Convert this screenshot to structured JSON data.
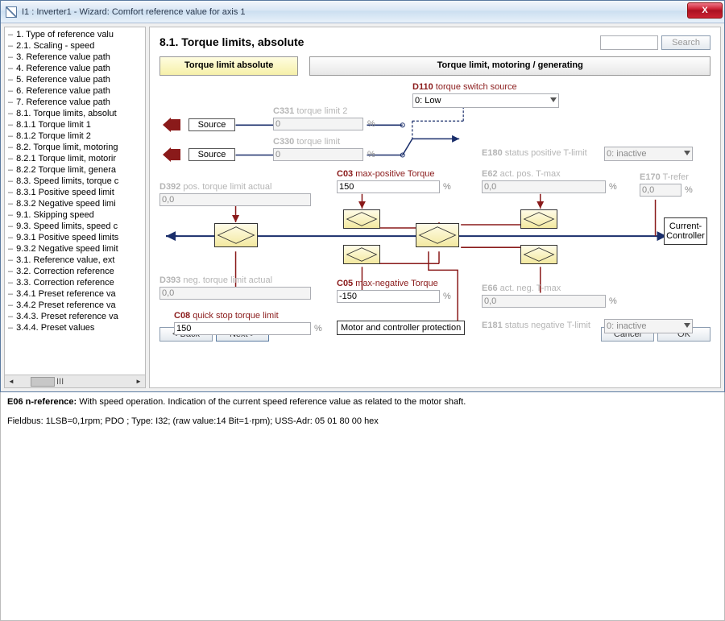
{
  "window": {
    "title": "I1 : Inverter1 - Wizard: Comfort reference value for axis 1",
    "close": "X"
  },
  "sidebar": {
    "items": [
      "1. Type of reference valu",
      "2.1. Scaling - speed",
      "3. Reference value path",
      "4. Reference value path",
      "5. Reference value path",
      "6. Reference value path",
      "7. Reference value path",
      "8.1. Torque limits, absolut",
      "8.1.1 Torque limit 1",
      "8.1.2 Torque limit 2",
      "8.2. Torque limit, motoring",
      "8.2.1 Torque limit, motorir",
      "8.2.2 Torque limit, genera",
      "8.3. Speed limits, torque c",
      "8.3.1 Positive speed limit",
      "8.3.2 Negative speed limi",
      "9.1. Skipping speed",
      "9.3. Speed limits, speed c",
      "9.3.1 Positive speed limits",
      "9.3.2 Negative speed limit",
      "3.1. Reference value, ext",
      "3.2. Correction reference",
      "3.3. Correction reference",
      "3.4.1 Preset reference va",
      "3.4.2 Preset reference va",
      "3.4.3. Preset reference va",
      "3.4.4. Preset values"
    ],
    "overflow": "III"
  },
  "main": {
    "heading": "8.1. Torque limits, absolute",
    "search_btn": "Search",
    "tabs": {
      "active": "Torque limit absolute",
      "inactive": "Torque limit, motoring / generating"
    },
    "d110": {
      "id": "D110",
      "label": "torque switch source",
      "value": "0: Low"
    },
    "c331": {
      "id": "C331",
      "label": "torque limit 2",
      "value": "0"
    },
    "c330": {
      "id": "C330",
      "label": "torque limit",
      "value": "0"
    },
    "source": "Source",
    "e180": {
      "id": "E180",
      "label": "status positive T-limit",
      "value": "0: inactive"
    },
    "d392": {
      "id": "D392",
      "label": "pos. torque limit actual",
      "value": "0,0"
    },
    "c03": {
      "id": "C03",
      "label": "max-positive Torque",
      "value": "150"
    },
    "e62": {
      "id": "E62",
      "label": "act. pos. T-max",
      "value": "0,0"
    },
    "e170": {
      "id": "E170",
      "label": "T-refer",
      "value": "0,0"
    },
    "d393": {
      "id": "D393",
      "label": "neg. torque limit actual",
      "value": "0,0"
    },
    "c05": {
      "id": "C05",
      "label": "max-negative Torque",
      "value": "-150"
    },
    "c08": {
      "id": "C08",
      "label": "quick stop torque limit",
      "value": "150"
    },
    "e66": {
      "id": "E66",
      "label": "act. neg. T-max",
      "value": "0,0"
    },
    "e181": {
      "id": "E181",
      "label": "status negative T-limit",
      "value": "0: inactive"
    },
    "motorbox": "Motor and controller protection",
    "outbox": "Current-Controller",
    "pct": "%"
  },
  "nav": {
    "back": "< Back",
    "next": "Next >",
    "cancel": "Cancel",
    "ok": "OK"
  },
  "status": {
    "line1_label": "E06  n-reference:",
    "line1_text": " With speed operation. Indication of the current speed reference value as related to the motor shaft.",
    "line2": "Fieldbus: 1LSB=0,1rpm; PDO ; Type: I32; (raw value:14 Bit=1·rpm); USS-Adr: 05 01 80 00 hex"
  }
}
